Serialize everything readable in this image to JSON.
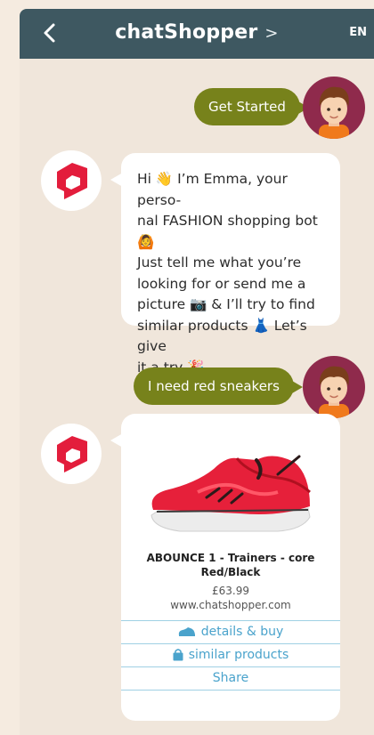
{
  "header": {
    "title": "chatShopper",
    "title_chevron": ">",
    "language": "EN"
  },
  "messages": {
    "user1": "Get Started",
    "bot1_lines": [
      "Hi 👋 I’m Emma, your perso-",
      "nal FASHION shopping bot 🙆",
      "Just tell me what you’re",
      "looking for or send me a",
      "picture 📷 & I’ll try to find",
      "similar products 👗 Let’s give",
      "it a try 🎉"
    ],
    "user2": "I need red sneakers"
  },
  "product": {
    "name": "ABOUNCE 1 - Trainers - core Red/Black",
    "price": "£63.99",
    "site": "www.chatshopper.com",
    "actions": {
      "details": "details & buy",
      "similar": "similar products",
      "share": "Share"
    }
  },
  "colors": {
    "header": "#3e5861",
    "user_bubble": "#77821b",
    "link": "#4aa3cc",
    "brand_red": "#e31d3c"
  }
}
